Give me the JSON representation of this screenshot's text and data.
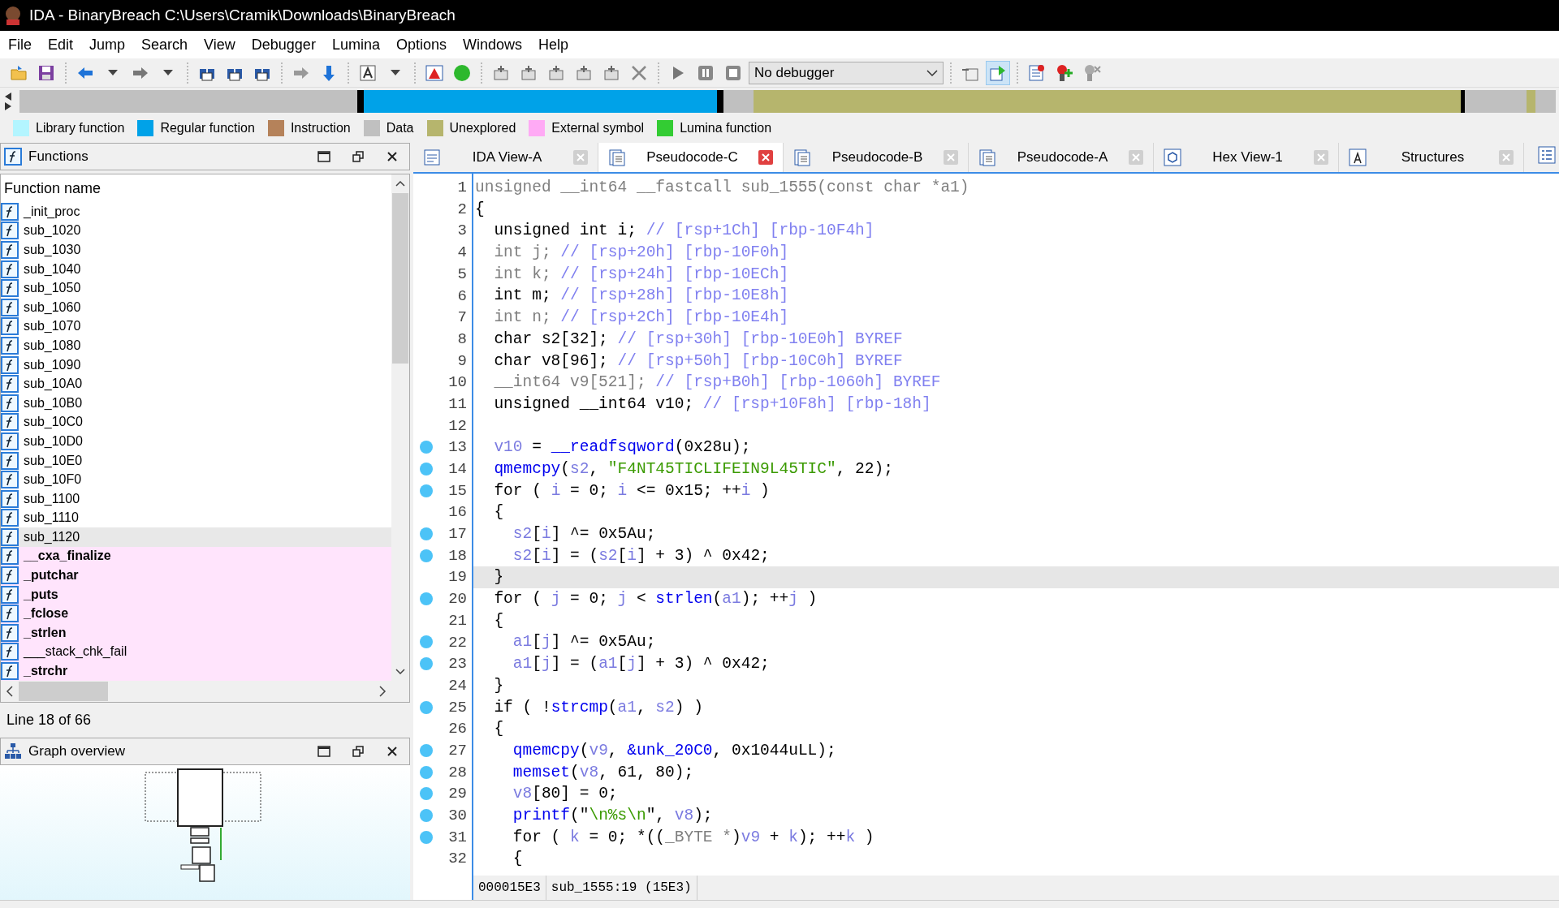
{
  "window": {
    "title": "IDA - BinaryBreach C:\\Users\\Cramik\\Downloads\\BinaryBreach"
  },
  "menu": [
    "File",
    "Edit",
    "Jump",
    "Search",
    "View",
    "Debugger",
    "Lumina",
    "Options",
    "Windows",
    "Help"
  ],
  "toolbar": {
    "debugger_select": "No debugger"
  },
  "legend": [
    {
      "label": "Library function",
      "color": "#b3f5ff"
    },
    {
      "label": "Regular function",
      "color": "#00a2e8"
    },
    {
      "label": "Instruction",
      "color": "#b5825a"
    },
    {
      "label": "Data",
      "color": "#c0c0c0"
    },
    {
      "label": "Unexplored",
      "color": "#b6b56d"
    },
    {
      "label": "External symbol",
      "color": "#ffaaf5"
    },
    {
      "label": "Lumina function",
      "color": "#33cc33"
    }
  ],
  "functions_panel": {
    "title": "Functions",
    "column": "Function name",
    "status": "Line 18 of 66",
    "items": [
      {
        "name": "_init_proc",
        "kind": "regular",
        "bold": false,
        "selected": false
      },
      {
        "name": "sub_1020",
        "kind": "regular",
        "bold": false,
        "selected": false
      },
      {
        "name": "sub_1030",
        "kind": "regular",
        "bold": false,
        "selected": false
      },
      {
        "name": "sub_1040",
        "kind": "regular",
        "bold": false,
        "selected": false
      },
      {
        "name": "sub_1050",
        "kind": "regular",
        "bold": false,
        "selected": false
      },
      {
        "name": "sub_1060",
        "kind": "regular",
        "bold": false,
        "selected": false
      },
      {
        "name": "sub_1070",
        "kind": "regular",
        "bold": false,
        "selected": false
      },
      {
        "name": "sub_1080",
        "kind": "regular",
        "bold": false,
        "selected": false
      },
      {
        "name": "sub_1090",
        "kind": "regular",
        "bold": false,
        "selected": false
      },
      {
        "name": "sub_10A0",
        "kind": "regular",
        "bold": false,
        "selected": false
      },
      {
        "name": "sub_10B0",
        "kind": "regular",
        "bold": false,
        "selected": false
      },
      {
        "name": "sub_10C0",
        "kind": "regular",
        "bold": false,
        "selected": false
      },
      {
        "name": "sub_10D0",
        "kind": "regular",
        "bold": false,
        "selected": false
      },
      {
        "name": "sub_10E0",
        "kind": "regular",
        "bold": false,
        "selected": false
      },
      {
        "name": "sub_10F0",
        "kind": "regular",
        "bold": false,
        "selected": false
      },
      {
        "name": "sub_1100",
        "kind": "regular",
        "bold": false,
        "selected": false
      },
      {
        "name": "sub_1110",
        "kind": "regular",
        "bold": false,
        "selected": false
      },
      {
        "name": "sub_1120",
        "kind": "regular",
        "bold": false,
        "selected": true
      },
      {
        "name": "__cxa_finalize",
        "kind": "external",
        "bold": true,
        "selected": false
      },
      {
        "name": "_putchar",
        "kind": "external",
        "bold": true,
        "selected": false
      },
      {
        "name": "_puts",
        "kind": "external",
        "bold": true,
        "selected": false
      },
      {
        "name": "_fclose",
        "kind": "external",
        "bold": true,
        "selected": false
      },
      {
        "name": "_strlen",
        "kind": "external",
        "bold": true,
        "selected": false
      },
      {
        "name": "___stack_chk_fail",
        "kind": "external",
        "bold": false,
        "selected": false
      },
      {
        "name": "_strchr",
        "kind": "external",
        "bold": true,
        "selected": false
      }
    ]
  },
  "graph_panel": {
    "title": "Graph overview"
  },
  "tabs": [
    {
      "label": "IDA View-A",
      "selected": false
    },
    {
      "label": "Pseudocode-C",
      "selected": true
    },
    {
      "label": "Pseudocode-B",
      "selected": false
    },
    {
      "label": "Pseudocode-A",
      "selected": false
    },
    {
      "label": "Hex View-1",
      "selected": false
    },
    {
      "label": "Structures",
      "selected": false
    }
  ],
  "code": {
    "status": [
      "000015E3",
      "sub_1555:19 (15E3)"
    ],
    "lines": [
      {
        "num": "1",
        "marked": false,
        "selected": false,
        "tokens": [
          {
            "kind": "g",
            "text": "unsigned __int64 __fastcall sub_1555(const char *a1)"
          }
        ]
      },
      {
        "num": "2",
        "marked": false,
        "selected": false,
        "tokens": [
          {
            "kind": "p",
            "text": "{"
          }
        ]
      },
      {
        "num": "3",
        "marked": false,
        "selected": false,
        "tokens": [
          {
            "kind": "p",
            "text": "  unsigned int i; "
          },
          {
            "kind": "c",
            "text": "// [rsp+1Ch] [rbp-10F4h]"
          }
        ]
      },
      {
        "num": "4",
        "marked": false,
        "selected": false,
        "tokens": [
          {
            "kind": "g",
            "text": "  int j; "
          },
          {
            "kind": "c",
            "text": "// [rsp+20h] [rbp-10F0h]"
          }
        ]
      },
      {
        "num": "5",
        "marked": false,
        "selected": false,
        "tokens": [
          {
            "kind": "g",
            "text": "  int k; "
          },
          {
            "kind": "c",
            "text": "// [rsp+24h] [rbp-10ECh]"
          }
        ]
      },
      {
        "num": "6",
        "marked": false,
        "selected": false,
        "tokens": [
          {
            "kind": "p",
            "text": "  int m; "
          },
          {
            "kind": "c",
            "text": "// [rsp+28h] [rbp-10E8h]"
          }
        ]
      },
      {
        "num": "7",
        "marked": false,
        "selected": false,
        "tokens": [
          {
            "kind": "g",
            "text": "  int n; "
          },
          {
            "kind": "c",
            "text": "// [rsp+2Ch] [rbp-10E4h]"
          }
        ]
      },
      {
        "num": "8",
        "marked": false,
        "selected": false,
        "tokens": [
          {
            "kind": "p",
            "text": "  char s2[32]; "
          },
          {
            "kind": "c",
            "text": "// [rsp+30h] [rbp-10E0h] BYREF"
          }
        ]
      },
      {
        "num": "9",
        "marked": false,
        "selected": false,
        "tokens": [
          {
            "kind": "p",
            "text": "  char v8[96]; "
          },
          {
            "kind": "c",
            "text": "// [rsp+50h] [rbp-10C0h] BYREF"
          }
        ]
      },
      {
        "num": "10",
        "marked": false,
        "selected": false,
        "tokens": [
          {
            "kind": "g",
            "text": "  __int64 v9[521]; "
          },
          {
            "kind": "c",
            "text": "// [rsp+B0h] [rbp-1060h] BYREF"
          }
        ]
      },
      {
        "num": "11",
        "marked": false,
        "selected": false,
        "tokens": [
          {
            "kind": "p",
            "text": "  unsigned __int64 v10; "
          },
          {
            "kind": "c",
            "text": "// [rsp+10F8h] [rbp-18h]"
          }
        ]
      },
      {
        "num": "12",
        "marked": false,
        "selected": false
      },
      {
        "num": "13",
        "marked": true,
        "selected": false,
        "tokens": [
          {
            "kind": "v",
            "text": "  v10"
          },
          {
            "kind": "p",
            "text": " = "
          },
          {
            "kind": "f",
            "text": "__readfsqword"
          },
          {
            "kind": "p",
            "text": "(0x28u);"
          }
        ]
      },
      {
        "num": "14",
        "marked": true,
        "selected": false,
        "tokens": [
          {
            "kind": "f",
            "text": "  qmemcpy"
          },
          {
            "kind": "p",
            "text": "("
          },
          {
            "kind": "v",
            "text": "s2"
          },
          {
            "kind": "p",
            "text": ", "
          },
          {
            "kind": "s",
            "text": "\"F4NT45TICLIFEIN9L45TIC\""
          },
          {
            "kind": "p",
            "text": ", 22);"
          }
        ]
      },
      {
        "num": "15",
        "marked": true,
        "selected": false,
        "tokens": [
          {
            "kind": "p",
            "text": "  for ( "
          },
          {
            "kind": "v",
            "text": "i"
          },
          {
            "kind": "p",
            "text": " = 0; "
          },
          {
            "kind": "v",
            "text": "i"
          },
          {
            "kind": "p",
            "text": " <= 0x15; ++"
          },
          {
            "kind": "v",
            "text": "i"
          },
          {
            "kind": "p",
            "text": " )"
          }
        ]
      },
      {
        "num": "16",
        "marked": false,
        "selected": false,
        "tokens": [
          {
            "kind": "p",
            "text": "  {"
          }
        ]
      },
      {
        "num": "17",
        "marked": true,
        "selected": false,
        "tokens": [
          {
            "kind": "v",
            "text": "    s2"
          },
          {
            "kind": "p",
            "text": "["
          },
          {
            "kind": "v",
            "text": "i"
          },
          {
            "kind": "p",
            "text": "] ^= 0x5Au;"
          }
        ]
      },
      {
        "num": "18",
        "marked": true,
        "selected": false,
        "tokens": [
          {
            "kind": "v",
            "text": "    s2"
          },
          {
            "kind": "p",
            "text": "["
          },
          {
            "kind": "v",
            "text": "i"
          },
          {
            "kind": "p",
            "text": "] = ("
          },
          {
            "kind": "v",
            "text": "s2"
          },
          {
            "kind": "p",
            "text": "["
          },
          {
            "kind": "v",
            "text": "i"
          },
          {
            "kind": "p",
            "text": "] + 3) ^ 0x42;"
          }
        ]
      },
      {
        "num": "19",
        "marked": false,
        "selected": true,
        "tokens": [
          {
            "kind": "p",
            "text": "  }"
          }
        ]
      },
      {
        "num": "20",
        "marked": true,
        "selected": false,
        "tokens": [
          {
            "kind": "p",
            "text": "  for ( "
          },
          {
            "kind": "v",
            "text": "j"
          },
          {
            "kind": "p",
            "text": " = 0; "
          },
          {
            "kind": "v",
            "text": "j"
          },
          {
            "kind": "p",
            "text": " < "
          },
          {
            "kind": "f",
            "text": "strlen"
          },
          {
            "kind": "p",
            "text": "("
          },
          {
            "kind": "v",
            "text": "a1"
          },
          {
            "kind": "p",
            "text": "); ++"
          },
          {
            "kind": "v",
            "text": "j"
          },
          {
            "kind": "p",
            "text": " )"
          }
        ]
      },
      {
        "num": "21",
        "marked": false,
        "selected": false,
        "tokens": [
          {
            "kind": "p",
            "text": "  {"
          }
        ]
      },
      {
        "num": "22",
        "marked": true,
        "selected": false,
        "tokens": [
          {
            "kind": "v",
            "text": "    a1"
          },
          {
            "kind": "p",
            "text": "["
          },
          {
            "kind": "v",
            "text": "j"
          },
          {
            "kind": "p",
            "text": "] ^= 0x5Au;"
          }
        ]
      },
      {
        "num": "23",
        "marked": true,
        "selected": false,
        "tokens": [
          {
            "kind": "v",
            "text": "    a1"
          },
          {
            "kind": "p",
            "text": "["
          },
          {
            "kind": "v",
            "text": "j"
          },
          {
            "kind": "p",
            "text": "] = ("
          },
          {
            "kind": "v",
            "text": "a1"
          },
          {
            "kind": "p",
            "text": "["
          },
          {
            "kind": "v",
            "text": "j"
          },
          {
            "kind": "p",
            "text": "] + 3) ^ 0x42;"
          }
        ]
      },
      {
        "num": "24",
        "marked": false,
        "selected": false,
        "tokens": [
          {
            "kind": "p",
            "text": "  }"
          }
        ]
      },
      {
        "num": "25",
        "marked": true,
        "selected": false,
        "tokens": [
          {
            "kind": "p",
            "text": "  if ( !"
          },
          {
            "kind": "f",
            "text": "strcmp"
          },
          {
            "kind": "p",
            "text": "("
          },
          {
            "kind": "v",
            "text": "a1"
          },
          {
            "kind": "p",
            "text": ", "
          },
          {
            "kind": "v",
            "text": "s2"
          },
          {
            "kind": "p",
            "text": ") )"
          }
        ]
      },
      {
        "num": "26",
        "marked": false,
        "selected": false,
        "tokens": [
          {
            "kind": "p",
            "text": "  {"
          }
        ]
      },
      {
        "num": "27",
        "marked": true,
        "selected": false,
        "tokens": [
          {
            "kind": "f",
            "text": "    qmemcpy"
          },
          {
            "kind": "p",
            "text": "("
          },
          {
            "kind": "v",
            "text": "v9"
          },
          {
            "kind": "p",
            "text": ", "
          },
          {
            "kind": "f",
            "text": "&unk_20C0"
          },
          {
            "kind": "p",
            "text": ", 0x1044uLL);"
          }
        ]
      },
      {
        "num": "28",
        "marked": true,
        "selected": false,
        "tokens": [
          {
            "kind": "f",
            "text": "    memset"
          },
          {
            "kind": "p",
            "text": "("
          },
          {
            "kind": "v",
            "text": "v8"
          },
          {
            "kind": "p",
            "text": ", 61, 80);"
          }
        ]
      },
      {
        "num": "29",
        "marked": true,
        "selected": false,
        "tokens": [
          {
            "kind": "v",
            "text": "    v8"
          },
          {
            "kind": "p",
            "text": "[80] = 0;"
          }
        ]
      },
      {
        "num": "30",
        "marked": true,
        "selected": false,
        "tokens": [
          {
            "kind": "f",
            "text": "    printf"
          },
          {
            "kind": "p",
            "text": "(\""
          },
          {
            "kind": "s",
            "text": "\\n%s\\n"
          },
          {
            "kind": "p",
            "text": "\", "
          },
          {
            "kind": "v",
            "text": "v8"
          },
          {
            "kind": "p",
            "text": ");"
          }
        ]
      },
      {
        "num": "31",
        "marked": true,
        "selected": false,
        "tokens": [
          {
            "kind": "p",
            "text": "    for ( "
          },
          {
            "kind": "v",
            "text": "k"
          },
          {
            "kind": "p",
            "text": " = 0; *(("
          },
          {
            "kind": "g",
            "text": "_BYTE *"
          },
          {
            "kind": "p",
            "text": ")"
          },
          {
            "kind": "v",
            "text": "v9"
          },
          {
            "kind": "p",
            "text": " + "
          },
          {
            "kind": "v",
            "text": "k"
          },
          {
            "kind": "p",
            "text": "); ++"
          },
          {
            "kind": "v",
            "text": "k"
          },
          {
            "kind": "p",
            "text": " )"
          }
        ]
      },
      {
        "num": "32",
        "marked": false,
        "selected": false,
        "tokens": [
          {
            "kind": "p",
            "text": "    {"
          }
        ]
      }
    ]
  }
}
